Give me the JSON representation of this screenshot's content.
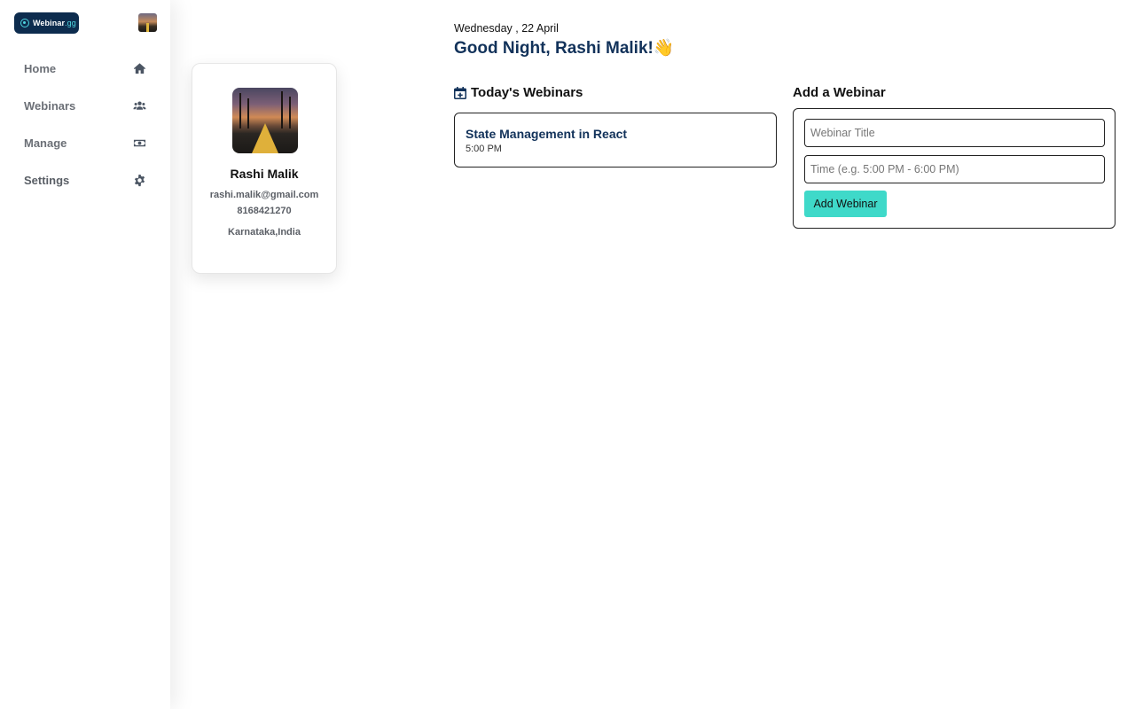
{
  "app": {
    "logo_text": "Webinar",
    "logo_suffix": ".gg"
  },
  "sidebar": {
    "items": [
      {
        "label": "Home",
        "icon": "home-icon"
      },
      {
        "label": "Webinars",
        "icon": "users-icon"
      },
      {
        "label": "Manage",
        "icon": "money-icon"
      },
      {
        "label": "Settings",
        "icon": "gear-icon"
      }
    ]
  },
  "profile": {
    "name": "Rashi Malik",
    "email": "rashi.malik@gmail.com",
    "phone": "8168421270",
    "location": "Karnataka,India"
  },
  "header": {
    "date": "Wednesday , 22 April",
    "greeting": "Good Night, Rashi Malik!👋"
  },
  "today": {
    "title": "Today's Webinars",
    "icon": "calendar-plus-icon",
    "webinars": [
      {
        "title": "State Management in React",
        "time": "5:00 PM"
      }
    ]
  },
  "add_webinar": {
    "title": "Add a Webinar",
    "title_placeholder": "Webinar Title",
    "time_placeholder": "Time (e.g. 5:00 PM - 6:00 PM)",
    "button_label": "Add Webinar",
    "button_color": "#3fd9c9"
  },
  "colors": {
    "brand_navy": "#12325a",
    "logo_bg": "#0d2c4e",
    "accent": "#3fd9c9"
  }
}
